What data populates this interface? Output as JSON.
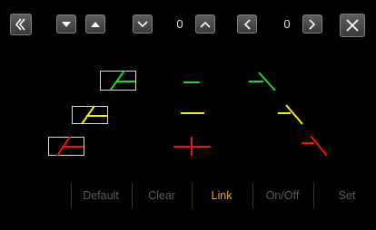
{
  "topbar": {
    "value_vertical": "0",
    "value_horizontal": "0"
  },
  "guides": {
    "colors": {
      "green": "#22d622",
      "yellow": "#f5f000",
      "red": "#ee1111"
    }
  },
  "bottom_menu": {
    "default_label": "Default",
    "clear_label": "Clear",
    "link_label": "Link",
    "onoff_label": "On/Off",
    "set_label": "Set",
    "active_color": "#e8a317",
    "inactive_color": "#5b5b5b"
  }
}
